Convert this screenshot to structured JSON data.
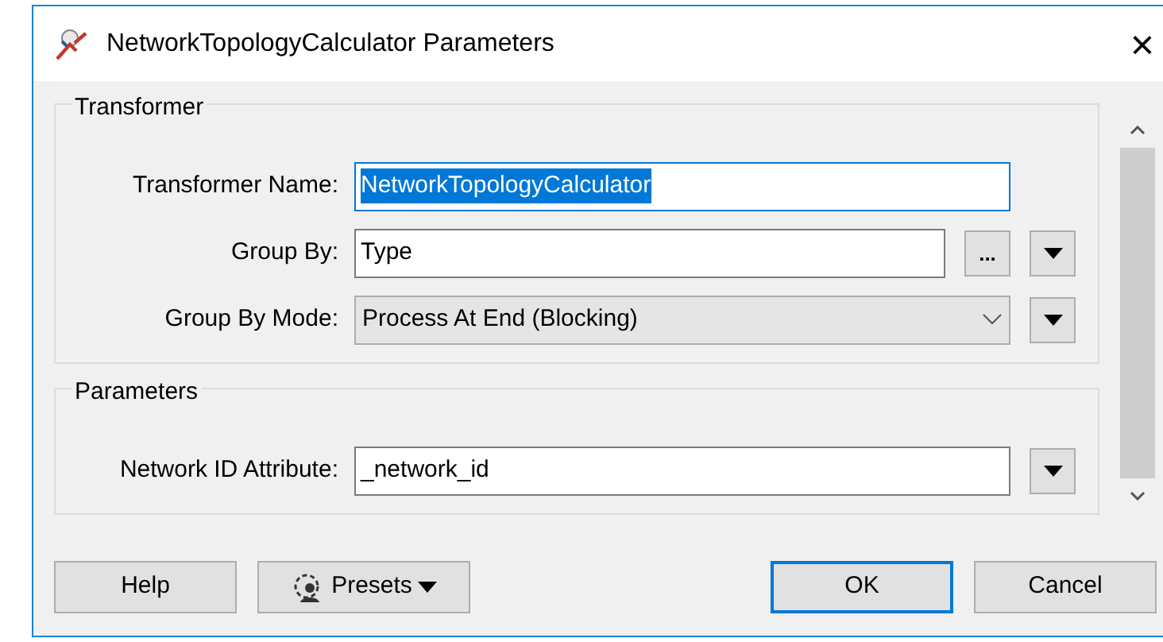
{
  "window": {
    "title": "NetworkTopologyCalculator Parameters",
    "close": "×"
  },
  "groups": [
    {
      "title": "Transformer",
      "fields": [
        {
          "label": "Transformer Name:",
          "kind": "text",
          "value": "NetworkTopologyCalculator",
          "text_selected": true
        },
        {
          "label": "Group By:",
          "kind": "text",
          "value": "Type",
          "text_selected": false,
          "buttons": [
            {
              "kind": "browse",
              "label": "..."
            },
            {
              "kind": "menu"
            }
          ]
        },
        {
          "label": "Group By Mode:",
          "kind": "select",
          "value": "Process At End (Blocking)",
          "buttons": [
            {
              "kind": "menu"
            }
          ]
        }
      ]
    },
    {
      "title": "Parameters",
      "fields": [
        {
          "label": "Network ID Attribute:",
          "kind": "text",
          "value": "_network_id",
          "text_selected": false,
          "buttons": [
            {
              "kind": "menu"
            }
          ]
        }
      ]
    }
  ],
  "buttons": [
    {
      "label": "Help",
      "kind": "plain",
      "default": false
    },
    {
      "label": "Presets",
      "kind": "presets",
      "default": false
    },
    {
      "label": "OK",
      "kind": "plain",
      "default": true
    },
    {
      "label": "Cancel",
      "kind": "plain",
      "default": false
    }
  ]
}
